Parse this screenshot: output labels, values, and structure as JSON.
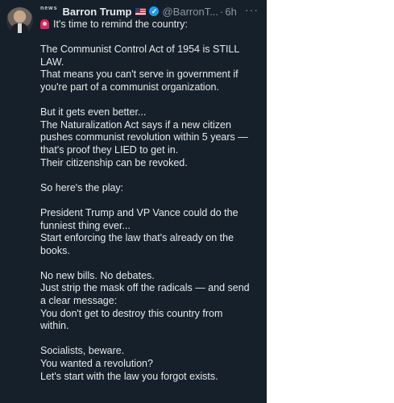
{
  "tweet": {
    "news_label": "news",
    "display_name": "Barron Trump",
    "handle": "@BarronT...",
    "separator": "·",
    "time": "6h",
    "more": "···",
    "icons": {
      "flag": "us-flag-icon",
      "verified": "verified-badge-icon",
      "siren": "siren-emoji-icon",
      "more": "more-options-icon"
    },
    "colors": {
      "background": "#15202b",
      "text": "#e7e9ea",
      "muted": "#8b98a5",
      "verified": "#1d9bf0"
    },
    "lines": [
      "It's time to remind the country:",
      "",
      "The Communist Control Act of 1954 is STILL",
      "LAW.",
      "That means you can't serve in government if",
      "you're part of a communist organization.",
      "",
      "But it gets even better...",
      "The Naturalization Act says if a new citizen",
      "pushes communist revolution within 5 years —",
      "that's proof they LIED to get in.",
      "Their citizenship can be revoked.",
      "",
      "So here's the play:",
      "",
      "President Trump and VP Vance could do the",
      "funniest thing ever...",
      "Start enforcing the law that's already on the",
      "books.",
      "",
      "No new bills. No debates.",
      "Just strip the mask off the radicals — and send",
      "a clear message:",
      "You don't get to destroy this country from",
      "within.",
      "",
      "Socialists, beware.",
      "You wanted a revolution?",
      "Let's start with the law you forgot exists."
    ]
  }
}
